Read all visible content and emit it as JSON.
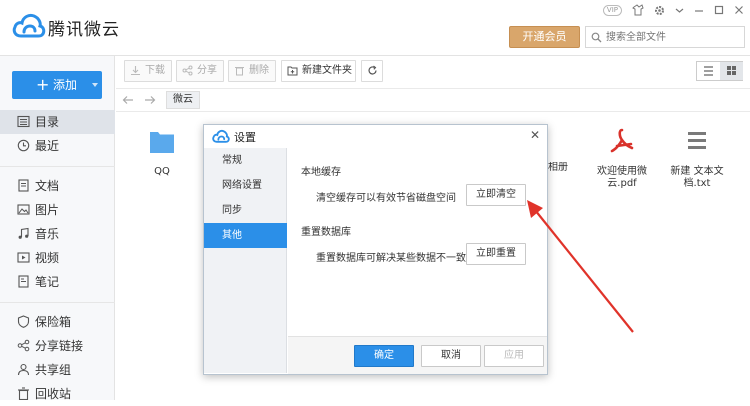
{
  "app": {
    "name": "腾讯微云"
  },
  "header": {
    "vip_button": "开通会员",
    "search_placeholder": "搜索全部文件",
    "vip_tag": "VIP"
  },
  "sidebar": {
    "add_button": "添加",
    "items": [
      {
        "label": "目录",
        "icon": "folder-list-icon"
      },
      {
        "label": "最近",
        "icon": "clock-icon"
      },
      {
        "label": "文档",
        "icon": "document-icon"
      },
      {
        "label": "图片",
        "icon": "image-icon"
      },
      {
        "label": "音乐",
        "icon": "music-icon"
      },
      {
        "label": "视频",
        "icon": "video-icon"
      },
      {
        "label": "笔记",
        "icon": "note-icon"
      },
      {
        "label": "保险箱",
        "icon": "shield-icon"
      },
      {
        "label": "分享链接",
        "icon": "share-link-icon"
      },
      {
        "label": "共享组",
        "icon": "group-icon"
      },
      {
        "label": "回收站",
        "icon": "trash-icon"
      }
    ]
  },
  "toolbar": {
    "download": "下载",
    "share": "分享",
    "delete": "删除",
    "new_folder": "新建文件夹"
  },
  "breadcrumb": {
    "current": "微云"
  },
  "files": [
    {
      "name": "QQ",
      "type": "folder"
    },
    {
      "name": "相册",
      "type": "folder"
    },
    {
      "name": "欢迎使用微云.pdf",
      "type": "pdf"
    },
    {
      "name": "新建 文本文档.txt",
      "type": "txt"
    }
  ],
  "dialog": {
    "title": "设置",
    "nav": [
      "常规",
      "网络设置",
      "同步",
      "其他"
    ],
    "active_nav": "其他",
    "cache_section": {
      "title": "本地缓存",
      "desc": "清空缓存可以有效节省磁盘空间",
      "button": "立即清空"
    },
    "db_section": {
      "title": "重置数据库",
      "desc": "重置数据库可解决某些数据不一致问题",
      "button": "立即重置"
    },
    "ok": "确定",
    "cancel": "取消",
    "apply": "应用"
  },
  "colors": {
    "accent": "#2b8fe8",
    "vip": "#d9a66b",
    "annotation_arrow": "#e0332a"
  }
}
